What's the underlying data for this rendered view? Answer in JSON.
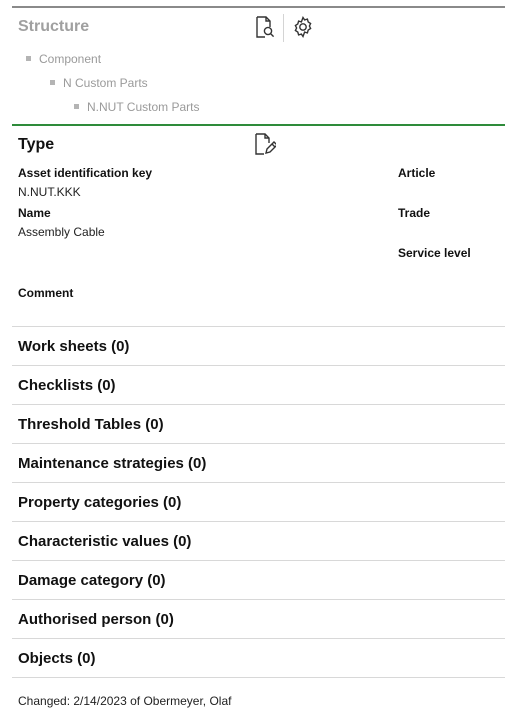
{
  "structure": {
    "title": "Structure",
    "tree": [
      {
        "label": "Component",
        "level": 1
      },
      {
        "label": "N Custom Parts",
        "level": 2
      },
      {
        "label": "N.NUT Custom Parts",
        "level": 3
      }
    ],
    "icons": {
      "search": "search-document-icon",
      "settings": "gear-icon"
    }
  },
  "type_section": {
    "title": "Type",
    "edit_icon": "edit-document-icon",
    "asset_key_label": "Asset identification key",
    "asset_key_value": "N.NUT.KKK",
    "name_label": "Name",
    "name_value": "Assembly Cable",
    "comment_label": "Comment",
    "article_label": "Article",
    "trade_label": "Trade",
    "service_level_label": "Service level"
  },
  "sections": [
    {
      "label": "Work sheets (0)"
    },
    {
      "label": "Checklists (0)"
    },
    {
      "label": "Threshold Tables (0)"
    },
    {
      "label": "Maintenance strategies (0)"
    },
    {
      "label": "Property categories (0)"
    },
    {
      "label": "Characteristic values (0)"
    },
    {
      "label": "Damage category (0)"
    },
    {
      "label": "Authorised person (0)"
    },
    {
      "label": "Objects (0)"
    }
  ],
  "footer": {
    "changed": "Changed: 2/14/2023 of Obermeyer, Olaf"
  },
  "colors": {
    "accent_rule": "#2e8b3a",
    "muted_text": "#9a9a9a"
  }
}
